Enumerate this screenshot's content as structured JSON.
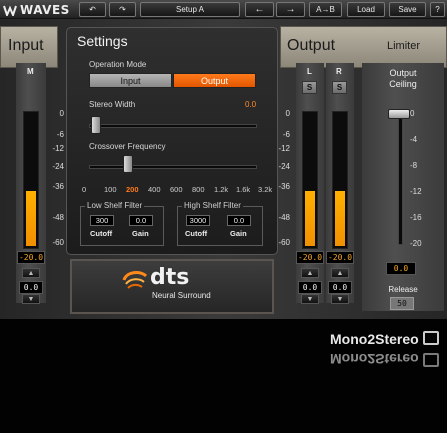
{
  "toolbar": {
    "brand": "WAVES",
    "undo_icon": "undo-icon",
    "redo_icon": "redo-icon",
    "preset": "Setup A",
    "prev": "←",
    "next": "→",
    "ab": "A→B",
    "load": "Load",
    "save": "Save",
    "help": "?"
  },
  "input": {
    "title": "Input",
    "channel": "M",
    "peak": "-20.0",
    "gain": "0.0",
    "level": 0.42
  },
  "settings": {
    "title": "Settings",
    "operation_mode_label": "Operation Mode",
    "mode_input": "Input",
    "mode_output": "Output",
    "stereo_width_label": "Stereo Width",
    "stereo_width_value": "0.0",
    "crossover_label": "Crossover Frequency",
    "freq_ticks": [
      "0",
      "100",
      "200",
      "400",
      "600",
      "800",
      "1.2k",
      "1.6k",
      "3.2k"
    ],
    "freq_selected": "200",
    "low_shelf_label": "Low Shelf Filter",
    "low_cutoff": "300",
    "low_gain": "0.0",
    "high_shelf_label": "High Shelf Filter",
    "high_cutoff": "3000",
    "high_gain": "0.0",
    "cutoff_label": "Cutoff",
    "gain_label": "Gain"
  },
  "dts": {
    "logo_text": "dts",
    "tagline": "Neural Surround"
  },
  "scale": [
    "0",
    "-6",
    "-12",
    "-24",
    "-36",
    "-48",
    "-60"
  ],
  "output": {
    "title": "Output",
    "limiter_label": "Limiter",
    "left_label": "L",
    "right_label": "R",
    "solo_label": "S",
    "left_peak": "-20.0",
    "right_peak": "-20.0",
    "left_gain": "0.0",
    "right_gain": "0.0",
    "left_level": 0.42,
    "right_level": 0.42
  },
  "limiter": {
    "ceiling_label": "Output\nCeiling",
    "scale": [
      "0",
      "-4",
      "-8",
      "-12",
      "-16",
      "-20"
    ],
    "ceiling_value": "0.0",
    "release_label": "Release",
    "release_value": "50"
  },
  "plugin_name": "Mono2Stereo",
  "plugin_name_reflection": "Mono2Stereo"
}
